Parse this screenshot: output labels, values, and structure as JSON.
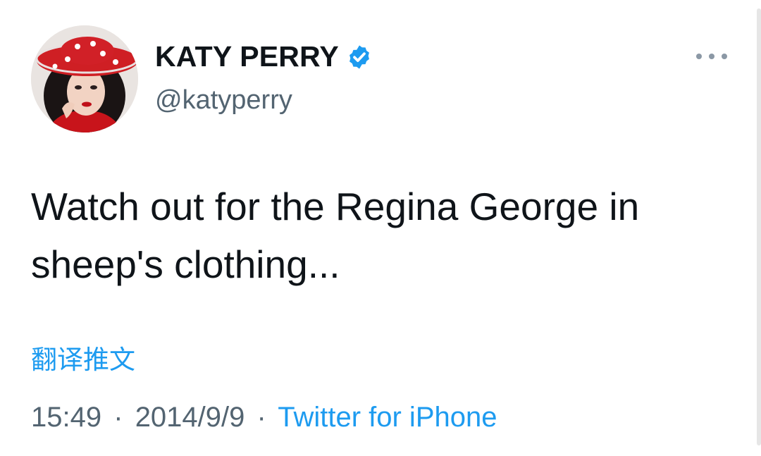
{
  "author": {
    "display_name": "KATY PERRY",
    "handle": "@katyperry",
    "verified": true
  },
  "icons": {
    "verified": "verified-badge-icon",
    "more": "more-options-icon"
  },
  "tweet": {
    "line1": "Watch out for the Regina George in",
    "line2": "sheep's clothing..."
  },
  "translate_label": "翻译推文",
  "meta": {
    "time": "15:49",
    "separator": "·",
    "date": "2014/9/9",
    "source": "Twitter for iPhone"
  },
  "colors": {
    "accent": "#1d9bf0",
    "secondary_text": "#536471",
    "primary_text": "#0f1419"
  }
}
